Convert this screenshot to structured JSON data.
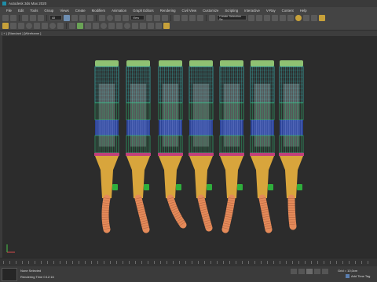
{
  "window": {
    "title": "Autodesk 3ds Max 2020"
  },
  "menu": [
    "File",
    "Edit",
    "Tools",
    "Group",
    "Views",
    "Create",
    "Modifiers",
    "Animation",
    "Graph Editors",
    "Rendering",
    "Civil View",
    "Customize",
    "Scripting",
    "Interactive",
    "V-Ray",
    "Content",
    "Help"
  ],
  "toolbar": {
    "undo_icon": "undo-icon",
    "redo_icon": "redo-icon",
    "selection_filter": "All",
    "reference_coord": "View",
    "named_selection": "Create Selection Se"
  },
  "viewport": {
    "label": "[ + ] [Standard ] [Wireframe ]",
    "object_colors": {
      "wire_top": "#9ad27a",
      "wire_cyan": "#3bd3d0",
      "wire_green": "#2fc27a",
      "wire_blue": "#2d4fc6",
      "band_pink": "#c0407a",
      "connector": "#d8a53c",
      "knob": "#2fae3c",
      "tube": "#e48a59",
      "background": "#2c2c2c"
    }
  },
  "status": {
    "selection": "None Selected",
    "render_time": "Rendering Time 0:12:16",
    "grid": "Grid = 10,0cm",
    "add_time_tag": "Add Time Tag"
  }
}
